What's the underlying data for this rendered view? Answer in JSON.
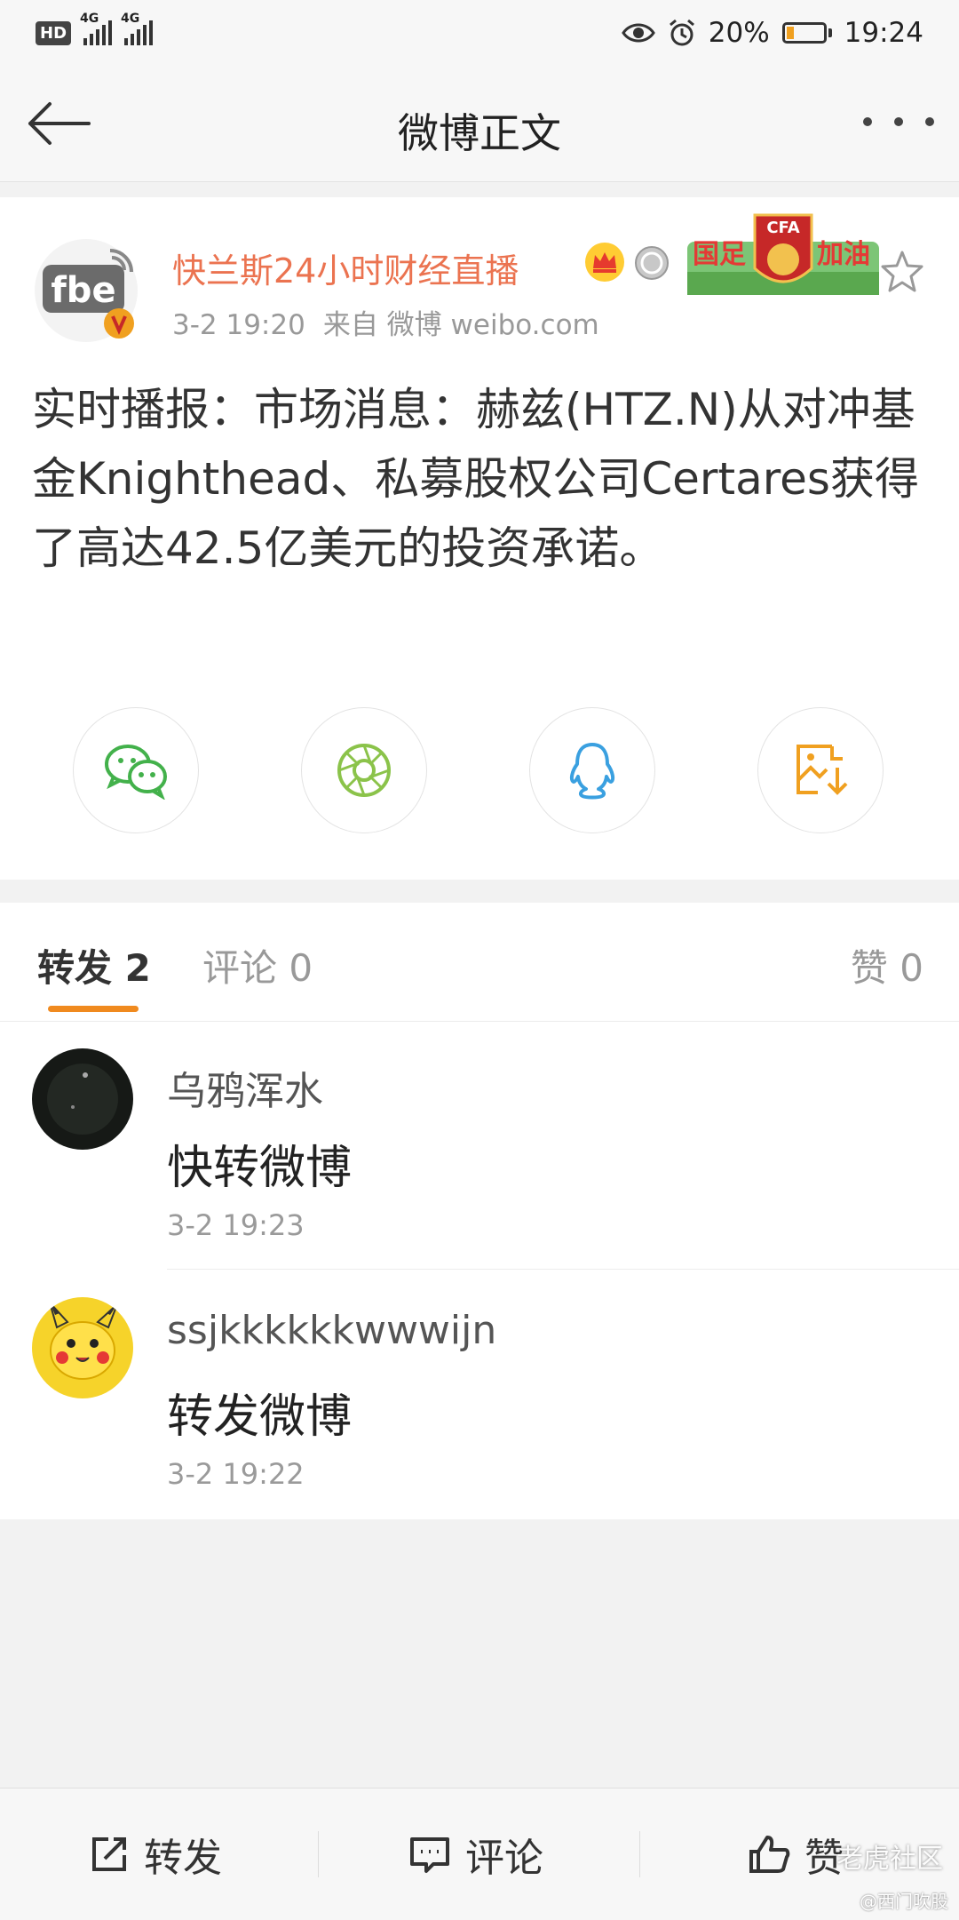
{
  "status_bar": {
    "hd": "HD",
    "sim1_network": "4G",
    "sim2_network": "4G",
    "battery_percent": "20%",
    "battery_level": 0.2,
    "time": "19:24"
  },
  "nav": {
    "title": "微博正文"
  },
  "post": {
    "author": "快兰斯24小时财经直播",
    "avatar_text": "fbe",
    "date": "3-2 19:20",
    "source": "来自 微博 weibo.com",
    "badge_text": "国足加油",
    "badge_emblem": "CFA",
    "content": "实时播报：市场消息：赫兹(HTZ.N)从对冲基金Knighthead、私募股权公司Certares获得了高达42.5亿美元的投资承诺。"
  },
  "share_buttons": [
    {
      "name": "wechat",
      "icon": "wechat-icon",
      "color": "#43b14b"
    },
    {
      "name": "moments",
      "icon": "moments-icon",
      "color": "#8bc34a"
    },
    {
      "name": "qq",
      "icon": "qq-icon",
      "color": "#3aa0e0"
    },
    {
      "name": "save-image",
      "icon": "save-image-icon",
      "color": "#f0a020"
    }
  ],
  "tabs": {
    "repost": "转发 2",
    "comment": "评论 0",
    "like": "赞 0"
  },
  "reposts": [
    {
      "user": "乌鸦浑水",
      "text": "快转微博",
      "time": "3-2 19:23"
    },
    {
      "user": "ssjkkkkkkwwwijn",
      "text": "转发微博",
      "time": "3-2 19:22"
    }
  ],
  "bottom_bar": {
    "repost": "转发",
    "comment": "评论",
    "like": "赞"
  },
  "watermark": {
    "main": "老虎社区",
    "sub": "@西门吹股"
  },
  "colors": {
    "accent": "#eb7350",
    "tab_indicator": "#f08a1f"
  }
}
